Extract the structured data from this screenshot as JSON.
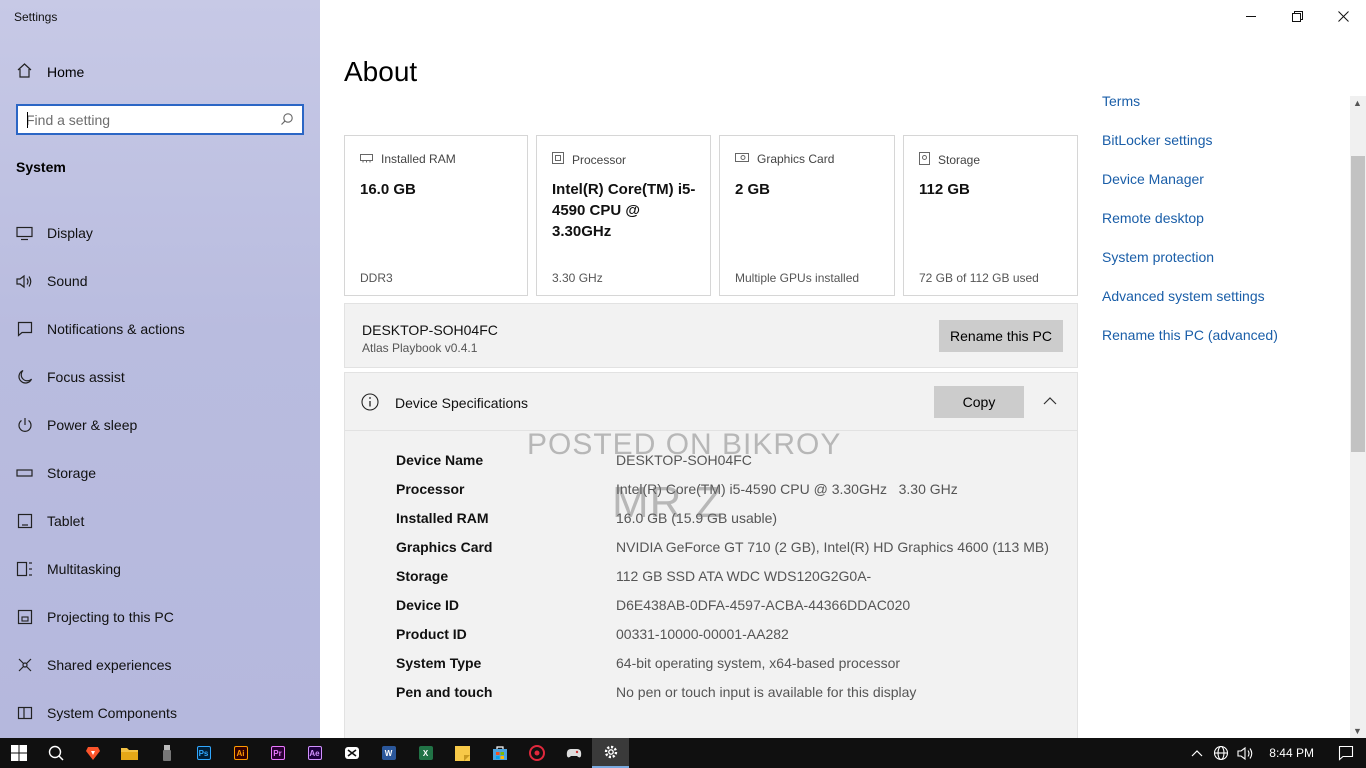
{
  "window": {
    "app_title": "Settings"
  },
  "sidebar": {
    "home_label": "Home",
    "search_placeholder": "Find a setting",
    "section": "System",
    "items": [
      {
        "label": "Display",
        "icon": "monitor-icon"
      },
      {
        "label": "Sound",
        "icon": "speaker-icon"
      },
      {
        "label": "Notifications & actions",
        "icon": "notification-icon"
      },
      {
        "label": "Focus assist",
        "icon": "moon-icon"
      },
      {
        "label": "Power & sleep",
        "icon": "power-icon"
      },
      {
        "label": "Storage",
        "icon": "storage-icon"
      },
      {
        "label": "Tablet",
        "icon": "tablet-icon"
      },
      {
        "label": "Multitasking",
        "icon": "multitasking-icon"
      },
      {
        "label": "Projecting to this PC",
        "icon": "projector-icon"
      },
      {
        "label": "Shared experiences",
        "icon": "share-icon"
      },
      {
        "label": "System Components",
        "icon": "components-icon"
      }
    ]
  },
  "main": {
    "title": "About",
    "cards": [
      {
        "header": "Installed RAM",
        "value": "16.0 GB",
        "sub": "DDR3",
        "icon": "ram-icon"
      },
      {
        "header": "Processor",
        "value": "Intel(R) Core(TM) i5-4590 CPU @ 3.30GHz",
        "sub": "3.30 GHz",
        "icon": "cpu-icon"
      },
      {
        "header": "Graphics Card",
        "value": "2 GB",
        "sub": "Multiple GPUs installed",
        "icon": "gpu-icon"
      },
      {
        "header": "Storage",
        "value": "112 GB",
        "sub": "72 GB of 112 GB used",
        "icon": "disk-icon"
      }
    ],
    "pc": {
      "name": "DESKTOP-SOH04FC",
      "sub": "Atlas Playbook v0.4.1",
      "rename_button": "Rename this PC"
    },
    "specs": {
      "title": "Device Specifications",
      "copy_button": "Copy",
      "rows": [
        {
          "k": "Device Name",
          "v": "DESKTOP-SOH04FC"
        },
        {
          "k": "Processor",
          "v": "Intel(R) Core(TM) i5-4590 CPU @ 3.30GHz   3.30 GHz"
        },
        {
          "k": "Installed RAM",
          "v": "16.0 GB (15.9 GB usable)"
        },
        {
          "k": "Graphics Card",
          "v": "NVIDIA GeForce GT 710 (2 GB), Intel(R) HD Graphics 4600 (113 MB)"
        },
        {
          "k": "Storage",
          "v": "112 GB SSD ATA WDC WDS120G2G0A-"
        },
        {
          "k": "Device ID",
          "v": "D6E438AB-0DFA-4597-ACBA-44366DDAC020"
        },
        {
          "k": "Product ID",
          "v": "00331-10000-00001-AA282"
        },
        {
          "k": "System Type",
          "v": "64-bit operating system, x64-based processor"
        },
        {
          "k": "Pen and touch",
          "v": "No pen or touch input is available for this display"
        }
      ]
    },
    "watermark": {
      "line1": "POSTED ON BIKROY",
      "line2": "MR Z"
    }
  },
  "related_links": [
    "Terms",
    "BitLocker settings",
    "Device Manager",
    "Remote desktop",
    "System protection",
    "Advanced system settings",
    "Rename this PC (advanced)"
  ],
  "taskbar": {
    "apps": [
      {
        "name": "search-icon"
      },
      {
        "name": "brave-icon",
        "color": "#fb542b"
      },
      {
        "name": "file-explorer-icon",
        "color": "#f3c244"
      },
      {
        "name": "usb-icon"
      },
      {
        "name": "photoshop-icon",
        "label": "Ps",
        "color": "#31a8ff",
        "bg": "#001e36"
      },
      {
        "name": "illustrator-icon",
        "label": "Ai",
        "color": "#ff9a00",
        "bg": "#330000"
      },
      {
        "name": "premiere-icon",
        "label": "Pr",
        "color": "#ea77ff",
        "bg": "#2a0034"
      },
      {
        "name": "after-effects-icon",
        "label": "Ae",
        "color": "#d291ff",
        "bg": "#1f0040"
      },
      {
        "name": "capcut-icon"
      },
      {
        "name": "word-icon",
        "label": "W",
        "color": "#fff",
        "bg": "#2b579a"
      },
      {
        "name": "excel-icon",
        "label": "X",
        "color": "#fff",
        "bg": "#217346"
      },
      {
        "name": "sticky-notes-icon",
        "color": "#f7c948"
      },
      {
        "name": "store-icon",
        "color": "#4aa3df"
      },
      {
        "name": "opera-icon",
        "color": "#e0283c"
      },
      {
        "name": "game-icon"
      },
      {
        "name": "settings-icon",
        "active": true
      }
    ],
    "clock": "8:44 PM"
  },
  "colors": {
    "accent": "#2b66c5",
    "link": "#1a5ea8",
    "sidebar": "#bcbfe0"
  }
}
